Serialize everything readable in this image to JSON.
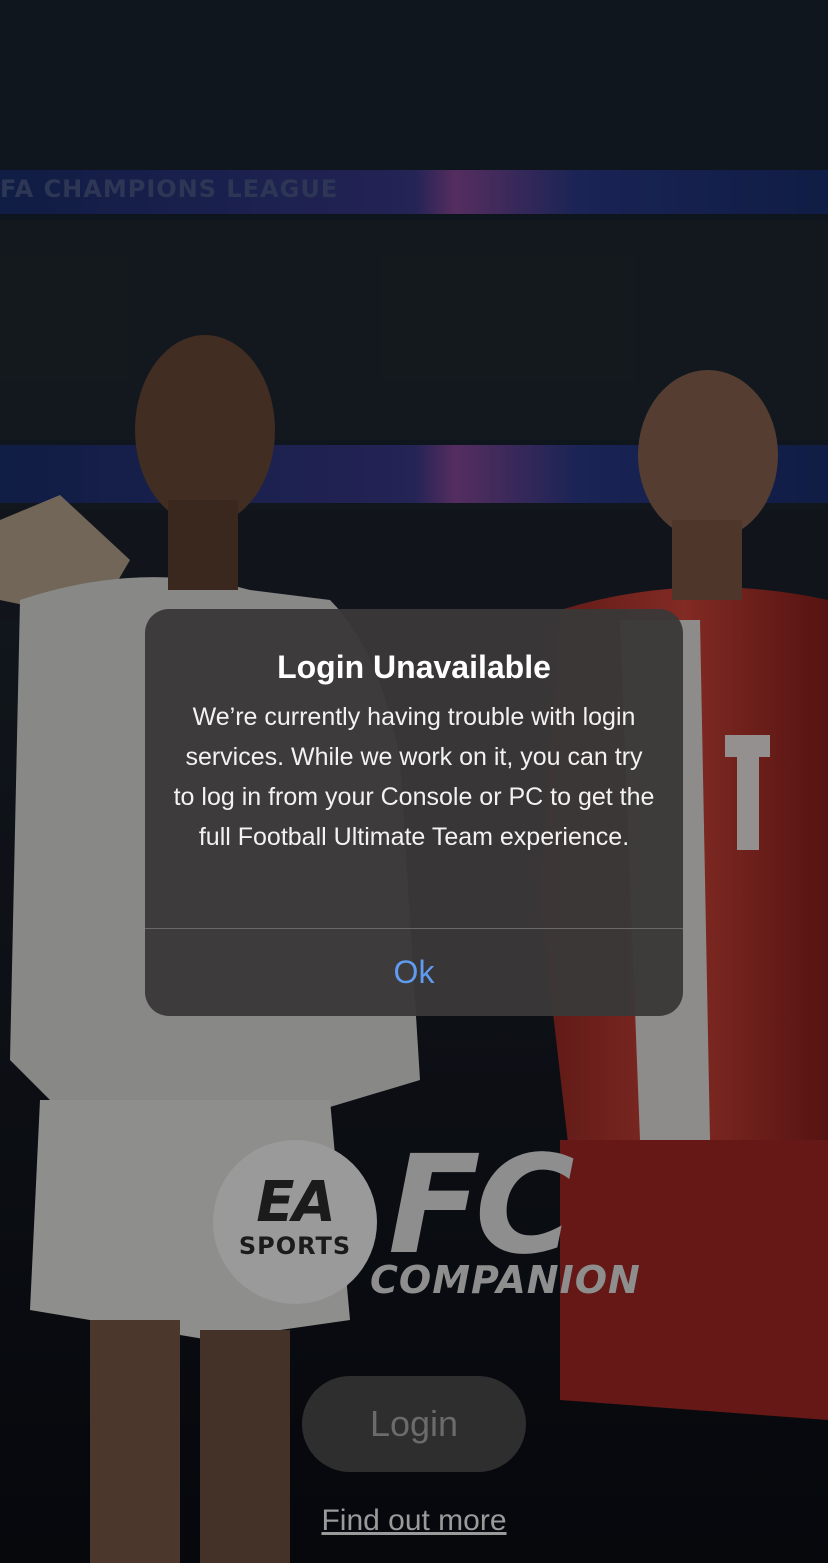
{
  "background": {
    "banner_text": "FA CHAMPIONS LEAGUE"
  },
  "logo": {
    "ea_letters": "EA",
    "ea_sports": "SPORTS",
    "fc": "FC",
    "companion": "COMPANION"
  },
  "login": {
    "button_label": "Login",
    "find_out_more": "Find out more"
  },
  "dialog": {
    "title": "Login Unavailable",
    "message": "We’re currently having trouble with login services. While we work on it, you can try to log in from your Console or PC to get the full Football Ultimate Team experience.",
    "ok_label": "Ok"
  },
  "colors": {
    "accent_link": "#5f9cf0",
    "dialog_bg": "#3a3838",
    "kit_red": "#b8322a",
    "banner_blue": "#1e3a8a"
  }
}
